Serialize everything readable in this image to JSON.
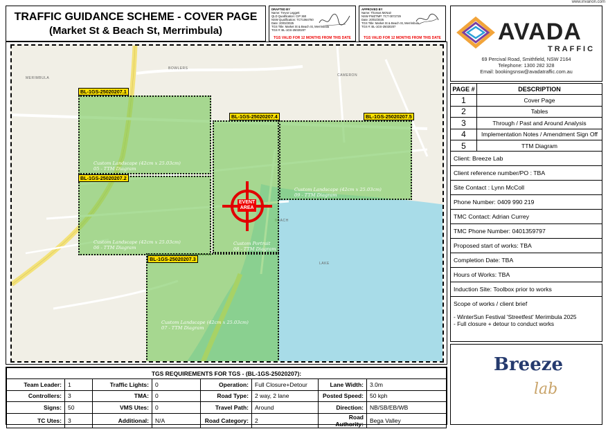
{
  "website": "www.invanon.com",
  "title": {
    "line1": "TRAFFIC GUIDANCE SCHEME - COVER PAGE",
    "line2": "(Market St & Beach St, Merrimbula)"
  },
  "drafted": {
    "heading": "DRAFTED BY",
    "lines": [
      "Name: Trevor Leggett",
      "QLD Qualification: CIP 360",
      "NSW Qualification: TCT1064750",
      "Date: 20/02/2025",
      "TGS Title: Market St & Beach St, Merrimbula",
      "TGS #: BL-1GS-25020207"
    ],
    "validity": "TGS VALID FOR 12 MONTHS FROM THIS DATE"
  },
  "approved": {
    "heading": "APPROVED BY",
    "lines": [
      "Name: Thomas McNair",
      "NSW PWZTMP: TCT 0072729",
      "Date: 20/02/2025",
      "TGS Title: Market St & Beach St, Merrimbula",
      "TGS #: BL-1GS-25020207"
    ],
    "validity": "TGS VALID FOR 12 MONTHS FROM THIS DATE"
  },
  "company": {
    "name": "AVADA",
    "sub": "TRAFFIC",
    "address": "69 Percival Road, Smithfield, NSW 2164",
    "telephone": "Telephone: 1300 282 328",
    "email": "Email: bookingsnsw@avadatraffic.com.au",
    "logo_colors": [
      "#f2a43a",
      "#7b3fa0",
      "#2aa0d8"
    ]
  },
  "pages_table": {
    "header_num": "PAGE #",
    "header_desc": "DESCRIPTION",
    "rows": [
      {
        "num": "1",
        "desc": "Cover Page"
      },
      {
        "num": "2",
        "desc": "Tables"
      },
      {
        "num": "3",
        "desc": "Through / Past and Around Analysis"
      },
      {
        "num": "4",
        "desc": "Implementation Notes / Amendment Sign Off"
      },
      {
        "num": "5",
        "desc": "TTM Diagram"
      }
    ]
  },
  "client_info": {
    "client": "Client: Breeze Lab",
    "reference": "Client reference number/PO : TBA",
    "site_contact": "Site Contact : Lynn McColl",
    "phone": "Phone Number: 0409 990 219",
    "tmc_contact": "TMC Contact: Adrian Currey",
    "tmc_phone": "TMC Phone Number: 0401359797",
    "start": "Proposed start of works: TBA",
    "completion": "Completion Date: TBA",
    "hours": "Hours of Works: TBA",
    "induction": "Induction Site: Toolbox prior to works",
    "scope_heading": "Scope of works / client brief",
    "scope_line1": "- WinterSun Festival 'Streetfest' Merimbula 2025",
    "scope_line2": "- Full closure + detour to conduct works"
  },
  "client_logo": {
    "word": "Breeze",
    "sub": "lab"
  },
  "map": {
    "zones": [
      {
        "label": "BL-1GS-25020207.1",
        "caption1": "Custom Landscape (42cm x 25.03cm)",
        "caption2": "05 - TTM Diagram"
      },
      {
        "label": "BL-1GS-25020207.2",
        "caption1": "Custom Landscape (42cm x 25.03cm)",
        "caption2": "06 - TTM Diagram"
      },
      {
        "label": "BL-1GS-25020207.3",
        "caption1": "Custom Landscape (42cm x 25.03cm)",
        "caption2": "07 - TTM Diagram"
      },
      {
        "label": "BL-1GS-25020207.4",
        "caption1": "Custom Portrait",
        "caption2": "08 - TTM Diagram"
      },
      {
        "label": "BL-1GS-25020207.5",
        "caption1": "Custom Landscape (42cm x 25.03cm)",
        "caption2": "09 - TTM Diagram"
      }
    ],
    "event_line1": "EVENT",
    "event_line2": "AREA",
    "street_labels": [
      "BOWLERS",
      "MERIMBULA",
      "LAKE",
      "CAMERON",
      "BEACH"
    ],
    "colors": {
      "zone": "#7cc85a",
      "water": "#a8dce8",
      "road": "#f3e27a",
      "target": "#e00000"
    }
  },
  "requirements": {
    "heading": "TGS REQUIREMENTS FOR TGS -  (BL-1GS-25020207):",
    "rows": [
      [
        {
          "k": "Team Leader:",
          "v": "1"
        },
        {
          "k": "Traffic Lights:",
          "v": "0"
        },
        {
          "k": "Operation:",
          "v": "Full Closure+Detour"
        },
        {
          "k": "Lane Width:",
          "v": "3.0m"
        }
      ],
      [
        {
          "k": "Controllers:",
          "v": "3"
        },
        {
          "k": "TMA:",
          "v": "0"
        },
        {
          "k": "Road Type:",
          "v": "2 way, 2 lane"
        },
        {
          "k": "Posted Speed:",
          "v": "50 kph"
        }
      ],
      [
        {
          "k": "Signs:",
          "v": "50"
        },
        {
          "k": "VMS Utes:",
          "v": "0"
        },
        {
          "k": "Travel Path:",
          "v": "Around"
        },
        {
          "k": "Direction:",
          "v": "NB/SB/EB/WB"
        }
      ],
      [
        {
          "k": "TC Utes:",
          "v": "3"
        },
        {
          "k": "Additional:",
          "v": "N/A"
        },
        {
          "k": "Road Category:",
          "v": "2"
        },
        {
          "k": "Road Authority:",
          "v": "Bega Valley"
        }
      ]
    ]
  }
}
